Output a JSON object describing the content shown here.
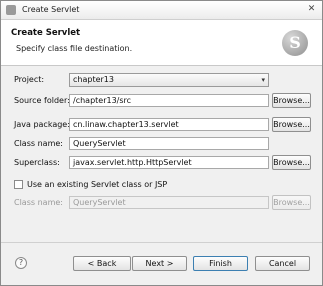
{
  "window": {
    "title": "Create Servlet"
  },
  "header": {
    "title": "Create Servlet",
    "description": "Specify class file destination."
  },
  "form": {
    "project_label": "Project:",
    "project_value": "chapter13",
    "source_folder_label": "Source folder:",
    "source_folder_value": "/chapter13/src",
    "java_package_label": "Java package:",
    "java_package_value": "cn.linaw.chapter13.servlet",
    "class_name_label": "Class name:",
    "class_name_value": "QueryServlet",
    "superclass_label": "Superclass:",
    "superclass_value": "javax.servlet.http.HttpServlet",
    "existing_checkbox_label": "Use an existing Servlet class or JSP",
    "existing_class_label": "Class name:",
    "existing_class_value": "QueryServlet",
    "browse_label": "Browse..."
  },
  "buttons": {
    "help": "?",
    "back": "< Back",
    "next": "Next >",
    "finish": "Finish",
    "cancel": "Cancel"
  },
  "icons": {
    "logo": "S",
    "close": "✕",
    "dropdown": "▾"
  }
}
